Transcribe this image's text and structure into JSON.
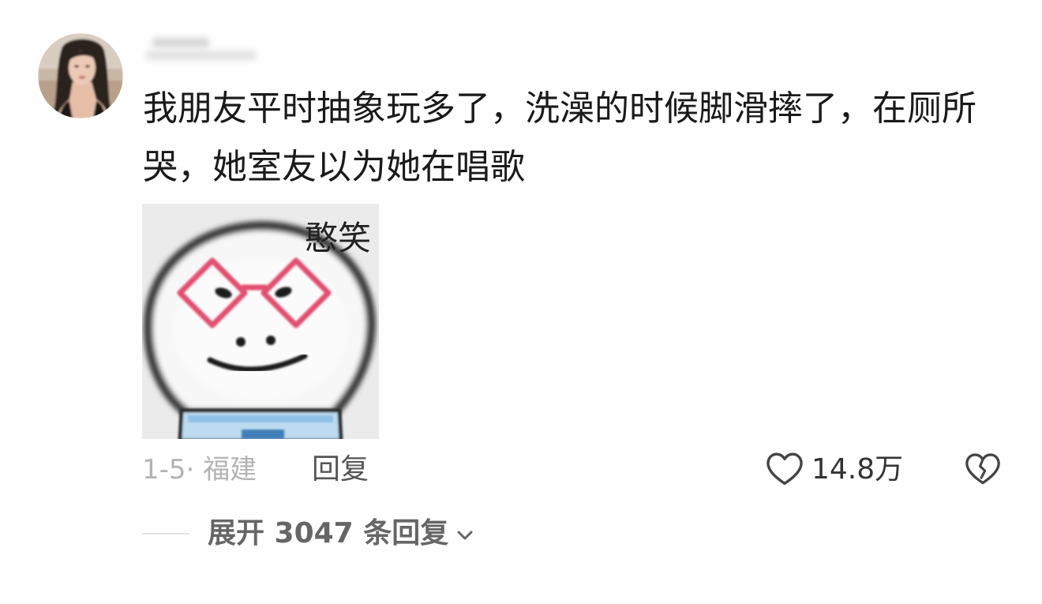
{
  "avatar": {
    "icon": "user-avatar-photo"
  },
  "comment": {
    "text": "我朋友平时抽象玩多了，洗澡的时候脚滑摔了，在厕所哭，她室友以为她在唱歌",
    "sticker": {
      "caption": "憨笑",
      "icon": "hanxiao-sticker"
    },
    "meta": "1-5· 福建",
    "reply_label": "回复",
    "likes": {
      "icon": "heart-outline-icon",
      "count": "14.8万"
    },
    "dislike": {
      "icon": "broken-heart-icon"
    }
  },
  "replies": {
    "expand_label": "展开 3047 条回复",
    "icon": "chevron-down-icon"
  },
  "colors": {
    "text": "#1a1a1a",
    "meta": "#b3b3b3",
    "action": "#555555",
    "expand": "#666666",
    "sticker_glasses": "#e2506f",
    "sticker_shirt": "#bcdaf0"
  }
}
